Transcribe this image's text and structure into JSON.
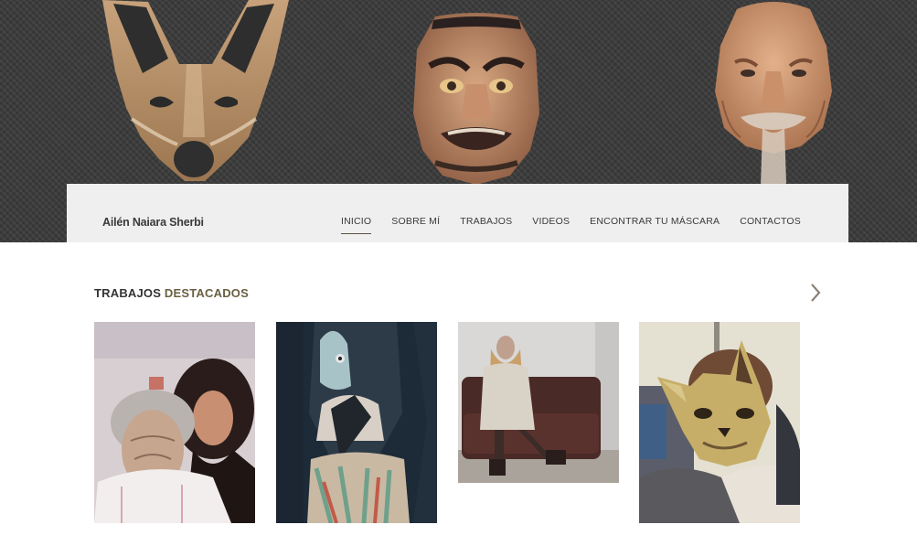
{
  "brand": {
    "name": "Ailén Naiara Sherbi"
  },
  "nav": {
    "items": [
      "INICIO",
      "SOBRE MÍ",
      "TRABAJOS",
      "VIDEOS",
      "ENCONTRAR TU MÁSCARA",
      "CONTACTOS"
    ],
    "active": "INICIO"
  },
  "featured": {
    "title_part1": "TRABAJOS",
    "title_part2": "DESTACADOS",
    "next_icon": "chevron-right-icon"
  },
  "colors": {
    "hero_bg": "#3c3c3c",
    "navbar_bg": "#efefef",
    "accent": "#6a6042",
    "text": "#333333"
  }
}
